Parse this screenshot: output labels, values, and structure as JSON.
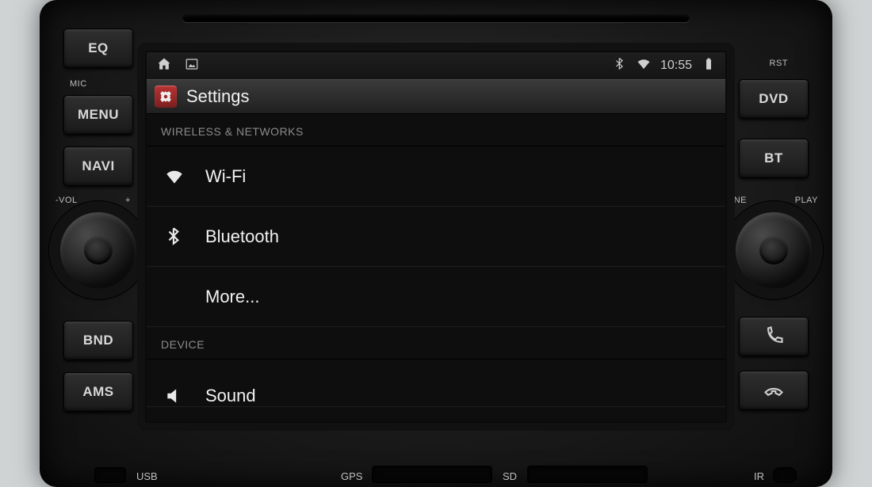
{
  "physical": {
    "eq": "EQ",
    "menu": "MENU",
    "navi": "NAVI",
    "bnd": "BND",
    "ams": "AMS",
    "rst": "RST",
    "dvd": "DVD",
    "bt": "BT",
    "mic": "MIC",
    "vol_minus": "-VOL",
    "vol_plus": "+",
    "tune": "TUNE",
    "play": "PLAY"
  },
  "statusbar": {
    "time": "10:55"
  },
  "titlebar": {
    "title": "Settings"
  },
  "sections": {
    "wireless_header": "WIRELESS & NETWORKS",
    "device_header": "DEVICE"
  },
  "rows": {
    "wifi": "Wi-Fi",
    "bluetooth": "Bluetooth",
    "more": "More...",
    "sound": "Sound"
  },
  "ports": {
    "usb": "USB",
    "gps": "GPS",
    "sd": "SD",
    "ir": "IR"
  }
}
